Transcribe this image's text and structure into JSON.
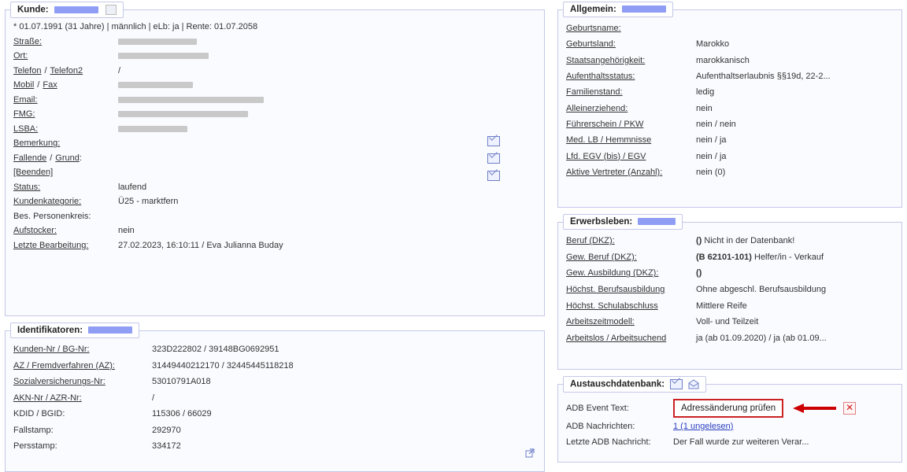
{
  "kunde": {
    "legend": "Kunde:",
    "info_line": "* 01.07.1991 (31 Jahre) | männlich | eLb: ja | Rente: 01.07.2058",
    "strasse": "Straße:",
    "ort": "Ort:",
    "telefon": "Telefon",
    "telefon2": "Telefon2",
    "telefon_value": "/",
    "mobil": "Mobil",
    "fax": "Fax",
    "email": "Email:",
    "fmg": "FMG:",
    "lsba": "LSBA:",
    "bemerkung": "Bemerkung:",
    "fallende": "Fallende",
    "grund": "Grund",
    "beenden": "[Beenden]",
    "status_label": "Status:",
    "status_value": "laufend",
    "kundenkategorie_label": "Kundenkategorie:",
    "kundenkategorie_value": "Ü25 - marktfern",
    "personenkreis_label": "Bes. Personenkreis:",
    "aufstocker_label": "Aufstocker:",
    "aufstocker_value": "nein",
    "letzte_label": "Letzte Bearbeitung:",
    "letzte_value": "27.02.2023, 16:10:11 / Eva Julianna Buday"
  },
  "ident": {
    "legend": "Identifikatoren:",
    "rows": [
      {
        "label": "Kunden-Nr / BG-Nr:",
        "value": "323D222802 / 39148BG0692951",
        "link": true
      },
      {
        "label": "AZ / Fremdverfahren (AZ):",
        "value": "31449440212170 / 32445445118218",
        "link": true
      },
      {
        "label": "Sozialversicherungs-Nr:",
        "value": "53010791A018",
        "link": true
      },
      {
        "label": "AKN-Nr / AZR-Nr:",
        "value": "/",
        "link": true
      },
      {
        "label": "KDID / BGID:",
        "value": "115306 / 66029",
        "link": false
      },
      {
        "label": "Fallstamp:",
        "value": "292970",
        "link": false
      },
      {
        "label": "Persstamp:",
        "value": "334172",
        "link": false
      }
    ]
  },
  "allgemein": {
    "legend": "Allgemein:",
    "rows": [
      {
        "label": "Geburtsname:",
        "value": ""
      },
      {
        "label": "Geburtsland:",
        "value": "Marokko"
      },
      {
        "label": "Staatsangehörigkeit:",
        "value": "marokkanisch"
      },
      {
        "label": "Aufenthaltsstatus:",
        "value": "Aufenthaltserlaubnis §§19d, 22-2..."
      },
      {
        "label": "Familienstand:",
        "value": "ledig"
      },
      {
        "label": "Alleinerziehend:",
        "value": "nein"
      },
      {
        "label": "Führerschein / PKW",
        "value": "nein / nein"
      },
      {
        "label": "Med. LB / Hemmnisse",
        "value": "nein / ja"
      },
      {
        "label": "Lfd. EGV (bis) / EGV",
        "value": "nein / ja"
      },
      {
        "label": "Aktive Vertreter (Anzahl):",
        "value": "nein (0)"
      }
    ]
  },
  "erwerb": {
    "legend": "Erwerbsleben:",
    "rows": [
      {
        "label": "Beruf (DKZ):",
        "bold": "()",
        "value": " Nicht in der Datenbank!"
      },
      {
        "label": "Gew. Beruf (DKZ):",
        "bold": "(B 62101-101)",
        "value": " Helfer/in - Verkauf"
      },
      {
        "label": "Gew. Ausbildung (DKZ):",
        "bold": "()",
        "value": ""
      },
      {
        "label": "Höchst. Berufsausbildung",
        "bold": "",
        "value": "Ohne abgeschl. Berufsausbildung"
      },
      {
        "label": "Höchst. Schulabschluss",
        "bold": "",
        "value": "Mittlere Reife"
      },
      {
        "label": "Arbeitszeitmodell:",
        "bold": "",
        "value": "Voll- und Teilzeit"
      },
      {
        "label": "Arbeitslos / Arbeitsuchend",
        "bold": "",
        "value": "ja (ab 01.09.2020) / ja (ab 01.09..."
      }
    ]
  },
  "adb": {
    "legend": "Austauschdatenbank:",
    "event_label": "ADB Event Text:",
    "event_value": "Adressänderung prüfen",
    "nachrichten_label": "ADB Nachrichten:",
    "nachrichten_value": "1 (1 ungelesen)",
    "letzte_label": "Letzte ADB Nachricht:",
    "letzte_value": "Der Fall wurde zur weiteren Verar..."
  },
  "colors": {
    "border": "#c4c8e8",
    "highlight": "#7b8cf2",
    "arrow": "#cc0000"
  }
}
